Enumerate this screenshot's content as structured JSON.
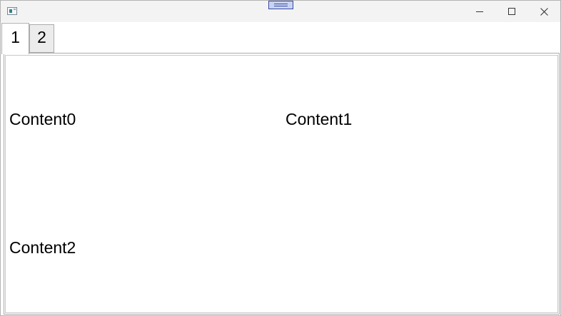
{
  "tabs": [
    {
      "label": "1",
      "selected": true
    },
    {
      "label": "2",
      "selected": false
    }
  ],
  "content": {
    "cells": [
      "Content0",
      "Content1",
      "Content2"
    ]
  },
  "window_controls": {
    "minimize": "minimize-icon",
    "maximize": "maximize-icon",
    "close": "close-icon"
  },
  "colors": {
    "titlebar": "#f3f3f3",
    "handle_fill": "#c8d3f3",
    "handle_border": "#3a4aa0",
    "tab_selected_bg": "#ffffff",
    "tab_unselected_bg": "#ececec"
  }
}
